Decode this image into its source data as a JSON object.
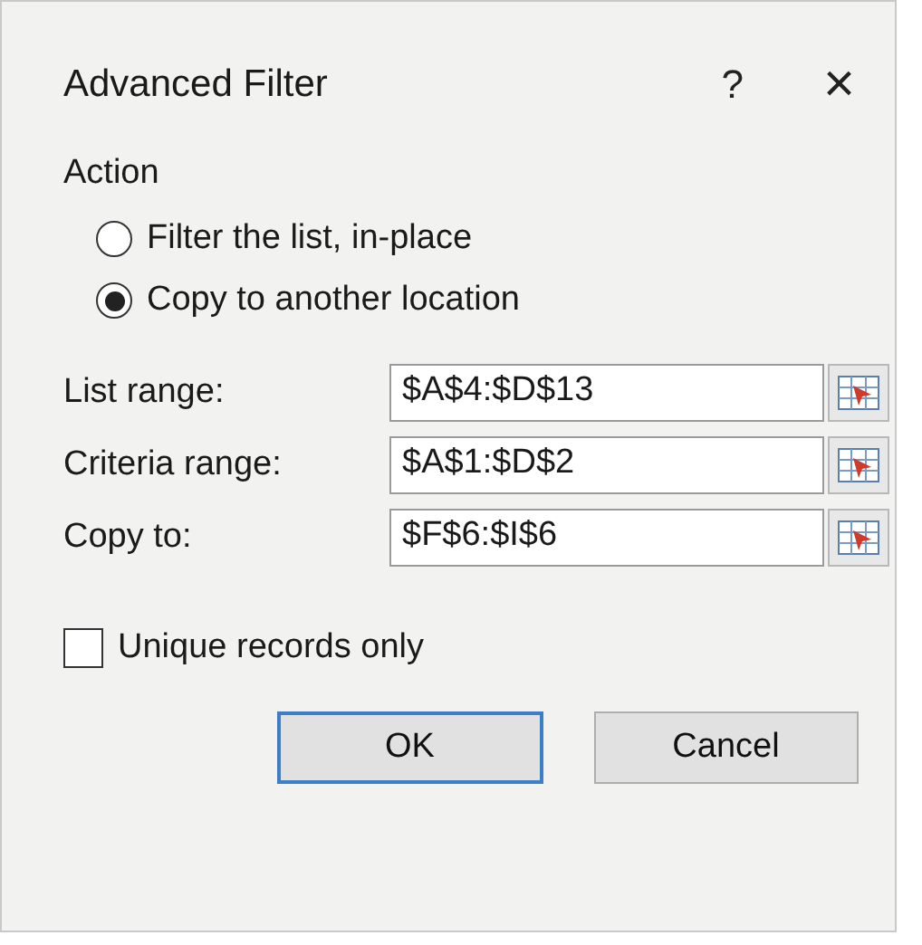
{
  "window": {
    "title": "Advanced Filter",
    "help": "?",
    "close": "×"
  },
  "action": {
    "label": "Action",
    "options": [
      {
        "label": "Filter the list, in-place",
        "selected": false
      },
      {
        "label": "Copy to another location",
        "selected": true
      }
    ]
  },
  "fields": [
    {
      "label": "List range:",
      "value": "$A$4:$D$13"
    },
    {
      "label": "Criteria range:",
      "value": "$A$1:$D$2"
    },
    {
      "label": "Copy to:",
      "value": "$F$6:$I$6"
    }
  ],
  "unique": {
    "label": "Unique records only",
    "checked": false
  },
  "buttons": [
    {
      "label": "OK",
      "default": true
    },
    {
      "label": "Cancel",
      "default": false
    }
  ]
}
